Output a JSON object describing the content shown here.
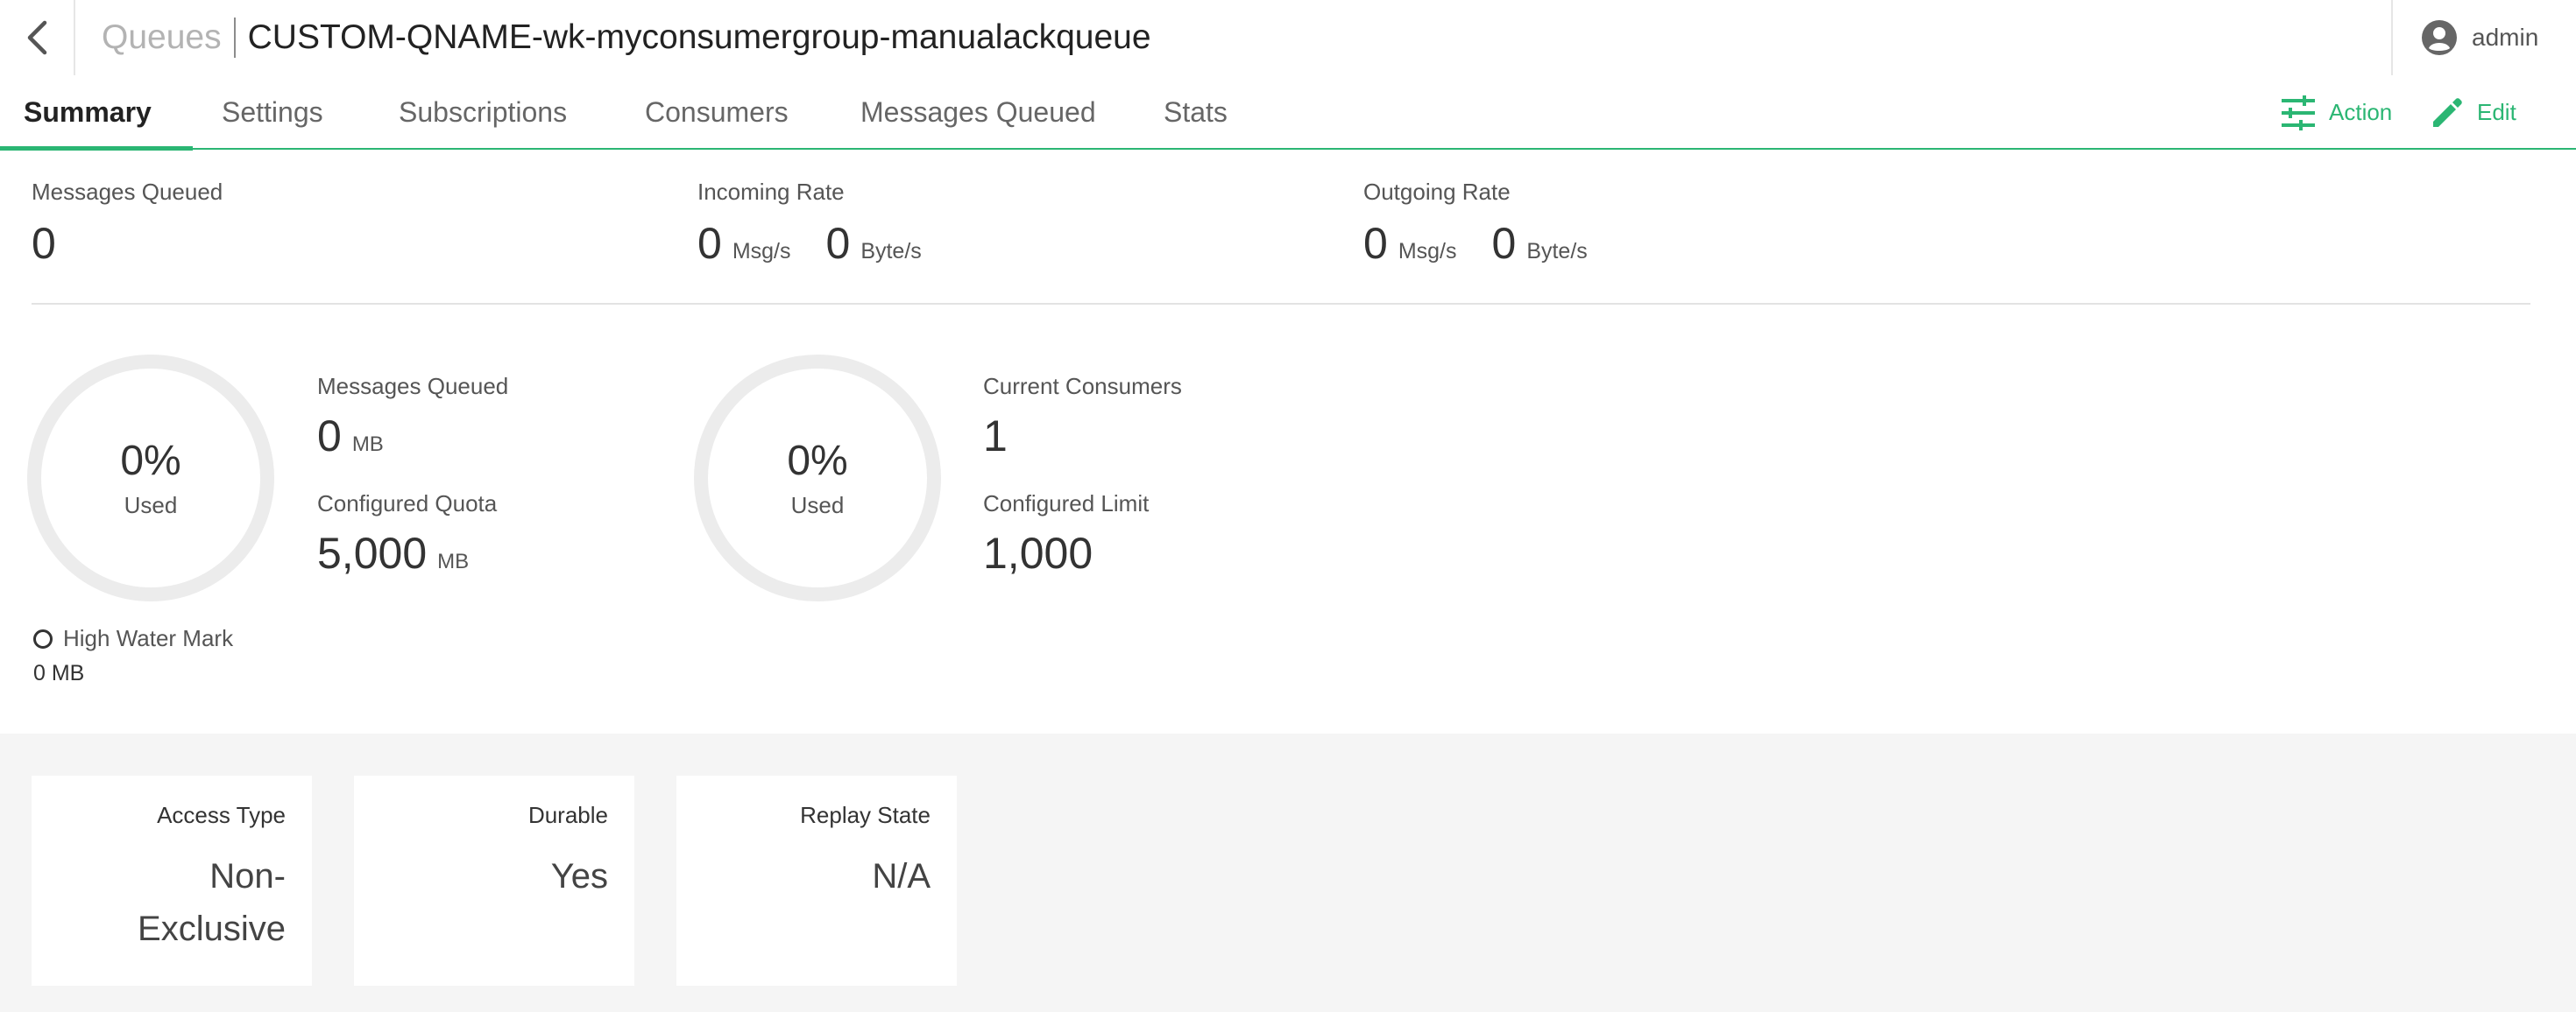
{
  "header": {
    "breadcrumb": "Queues",
    "title": "CUSTOM-QNAME-wk-myconsumergroup-manualackqueue",
    "user": "admin"
  },
  "tabs": [
    {
      "label": "Summary",
      "active": true
    },
    {
      "label": "Settings",
      "active": false
    },
    {
      "label": "Subscriptions",
      "active": false
    },
    {
      "label": "Consumers",
      "active": false
    },
    {
      "label": "Messages Queued",
      "active": false
    },
    {
      "label": "Stats",
      "active": false
    }
  ],
  "actions": {
    "action_label": "Action",
    "edit_label": "Edit"
  },
  "metrics": {
    "messages_queued": {
      "label": "Messages Queued",
      "value": "0"
    },
    "incoming_rate": {
      "label": "Incoming Rate",
      "msg_value": "0",
      "msg_unit": "Msg/s",
      "byte_value": "0",
      "byte_unit": "Byte/s"
    },
    "outgoing_rate": {
      "label": "Outgoing Rate",
      "msg_value": "0",
      "msg_unit": "Msg/s",
      "byte_value": "0",
      "byte_unit": "Byte/s"
    }
  },
  "storage": {
    "gauge_percent": "0%",
    "gauge_label": "Used",
    "queued_label": "Messages Queued",
    "queued_value": "0",
    "queued_unit": "MB",
    "quota_label": "Configured Quota",
    "quota_value": "5,000",
    "quota_unit": "MB",
    "hwm_label": "High Water Mark",
    "hwm_value": "0 MB"
  },
  "consumers": {
    "gauge_percent": "0%",
    "gauge_label": "Used",
    "current_label": "Current Consumers",
    "current_value": "1",
    "limit_label": "Configured Limit",
    "limit_value": "1,000"
  },
  "cards": [
    {
      "label": "Access Type",
      "value": "Non-Exclusive"
    },
    {
      "label": "Durable",
      "value": "Yes"
    },
    {
      "label": "Replay State",
      "value": "N/A"
    }
  ],
  "colors": {
    "accent": "#2bb673",
    "background_panel": "#f5f5f5"
  },
  "icons": {
    "back": "chevron-left-icon",
    "user": "user-circle-icon",
    "action": "sliders-icon",
    "edit": "pencil-icon"
  }
}
